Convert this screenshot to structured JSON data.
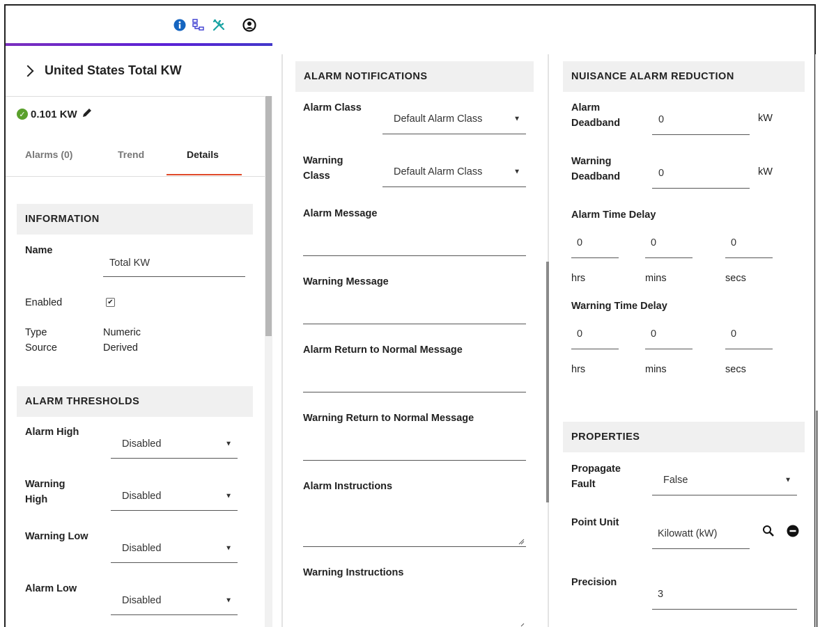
{
  "header": {
    "icons": [
      "info-icon",
      "hierarchy-icon",
      "tools-icon",
      "user-icon"
    ],
    "accent_color": "#6a2bc9"
  },
  "point": {
    "title": "United States Total KW",
    "value": "0.101 KW",
    "status_color": "#5aa02c"
  },
  "tabs": [
    {
      "label": "Alarms (0)"
    },
    {
      "label": "Trend"
    },
    {
      "label": "Details"
    }
  ],
  "information": {
    "heading": "INFORMATION",
    "name_label": "Name",
    "name_value": "Total KW",
    "enabled_label": "Enabled",
    "enabled_checked": true,
    "type_label": "Type",
    "type_value": "Numeric",
    "source_label": "Source",
    "source_value": "Derived"
  },
  "alarm_thresholds": {
    "heading": "ALARM THRESHOLDS",
    "rows": [
      {
        "label_1": "Alarm High",
        "label_2": "",
        "value": "Disabled"
      },
      {
        "label_1": "Warning",
        "label_2": "High",
        "value": "Disabled"
      },
      {
        "label_1": "Warning Low",
        "label_2": "",
        "value": "Disabled"
      },
      {
        "label_1": "Alarm Low",
        "label_2": "",
        "value": "Disabled"
      }
    ]
  },
  "alarm_notifications": {
    "heading": "ALARM NOTIFICATIONS",
    "alarm_class_label": "Alarm Class",
    "alarm_class_value": "Default Alarm Class",
    "warning_class_label_1": "Warning",
    "warning_class_label_2": "Class",
    "warning_class_value": "Default Alarm Class",
    "messages": [
      {
        "label": "Alarm Message",
        "value": ""
      },
      {
        "label": "Warning Message",
        "value": ""
      },
      {
        "label": "Alarm Return to Normal Message",
        "value": ""
      },
      {
        "label": "Warning Return to Normal Message",
        "value": ""
      }
    ],
    "alarm_instructions_label": "Alarm Instructions",
    "alarm_instructions_value": "",
    "warning_instructions_label": "Warning Instructions",
    "warning_instructions_value": ""
  },
  "nuisance": {
    "heading": "NUISANCE ALARM REDUCTION",
    "alarm_deadband_label_1": "Alarm",
    "alarm_deadband_label_2": "Deadband",
    "alarm_deadband_value": "0",
    "warning_deadband_label_1": "Warning",
    "warning_deadband_label_2": "Deadband",
    "warning_deadband_value": "0",
    "unit": "kW",
    "alarm_time_delay_label": "Alarm Time Delay",
    "alarm_delay": {
      "hrs": "0",
      "mins": "0",
      "secs": "0"
    },
    "warning_time_delay_label": "Warning Time Delay",
    "warning_delay": {
      "hrs": "0",
      "mins": "0",
      "secs": "0"
    },
    "hrs_label": "hrs",
    "mins_label": "mins",
    "secs_label": "secs"
  },
  "properties": {
    "heading": "PROPERTIES",
    "propagate_label_1": "Propagate",
    "propagate_label_2": "Fault",
    "propagate_value": "False",
    "point_unit_label": "Point Unit",
    "point_unit_value": "Kilowatt (kW)",
    "precision_label": "Precision",
    "precision_value": "3"
  }
}
